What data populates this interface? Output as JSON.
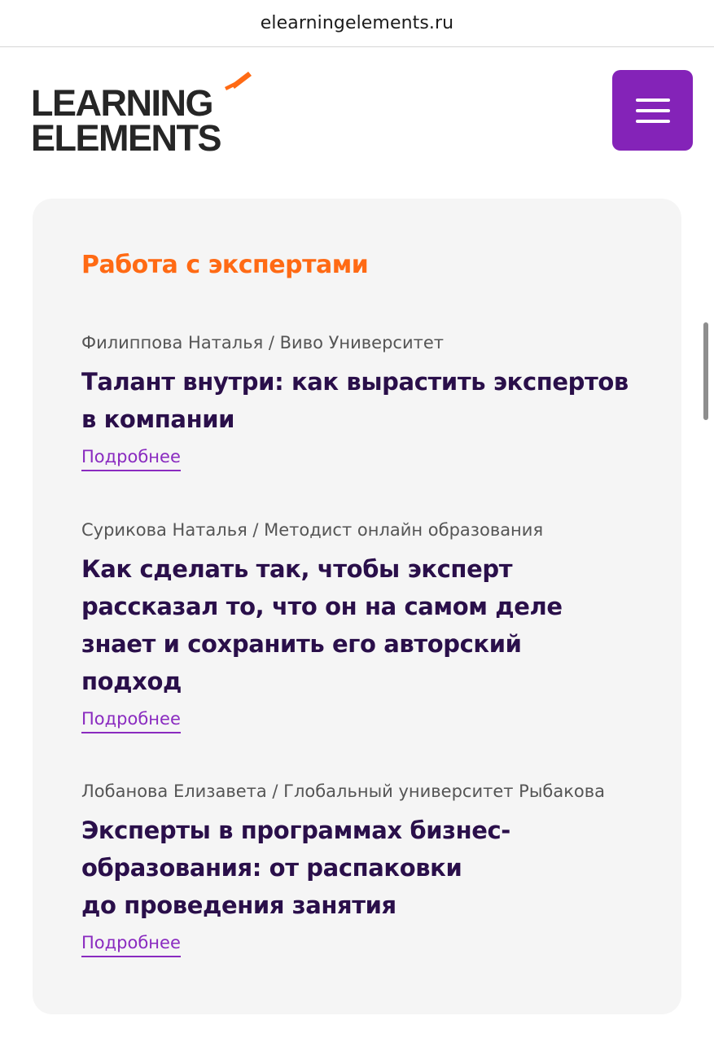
{
  "browser": {
    "url": "elearningelements.ru"
  },
  "header": {
    "logo_line1": "LEARNING",
    "logo_line2": "ELEMENTS",
    "logo_accent_color": "#ff6a14",
    "menu_button_color": "#8423b8",
    "menu_icon": "hamburger-icon"
  },
  "section": {
    "title": "Работа с экспертами",
    "title_color": "#ff6a14",
    "articles": [
      {
        "author": "Филиппова Наталья / Виво Университет",
        "title": "Талант внутри: как вырастить экспертов в компании",
        "link": "Подробнее"
      },
      {
        "author": "Сурикова Наталья / Методист онлайн образования",
        "title": "Как сделать так, чтобы эксперт рассказал то, что он на самом деле знает и сохранить его авторский подход",
        "link": "Подробнее"
      },
      {
        "author": "Лобанова Елизавета / Глобальный университет Рыбакова",
        "title": "Эксперты в программах бизнес-образования: от распаковки до проведения занятия",
        "link": "Подробнее"
      }
    ]
  }
}
